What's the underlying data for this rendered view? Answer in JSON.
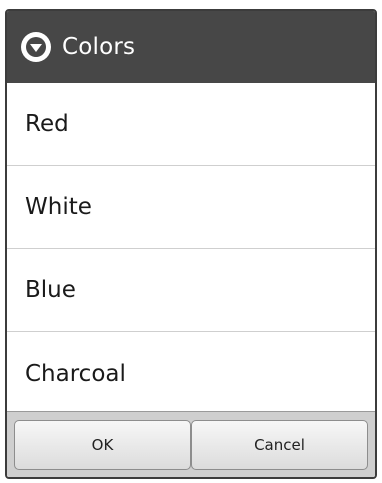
{
  "dialog": {
    "title": "Colors",
    "title_icon": "chevron-down-circle-icon",
    "items": [
      {
        "label": "Red"
      },
      {
        "label": "White"
      },
      {
        "label": "Blue"
      },
      {
        "label": "Charcoal"
      }
    ],
    "buttons": {
      "ok_label": "OK",
      "cancel_label": "Cancel"
    }
  },
  "colors": {
    "titlebar": "#474747",
    "buttonbar": "#cfcfcf",
    "divider": "#cfcfcf"
  }
}
